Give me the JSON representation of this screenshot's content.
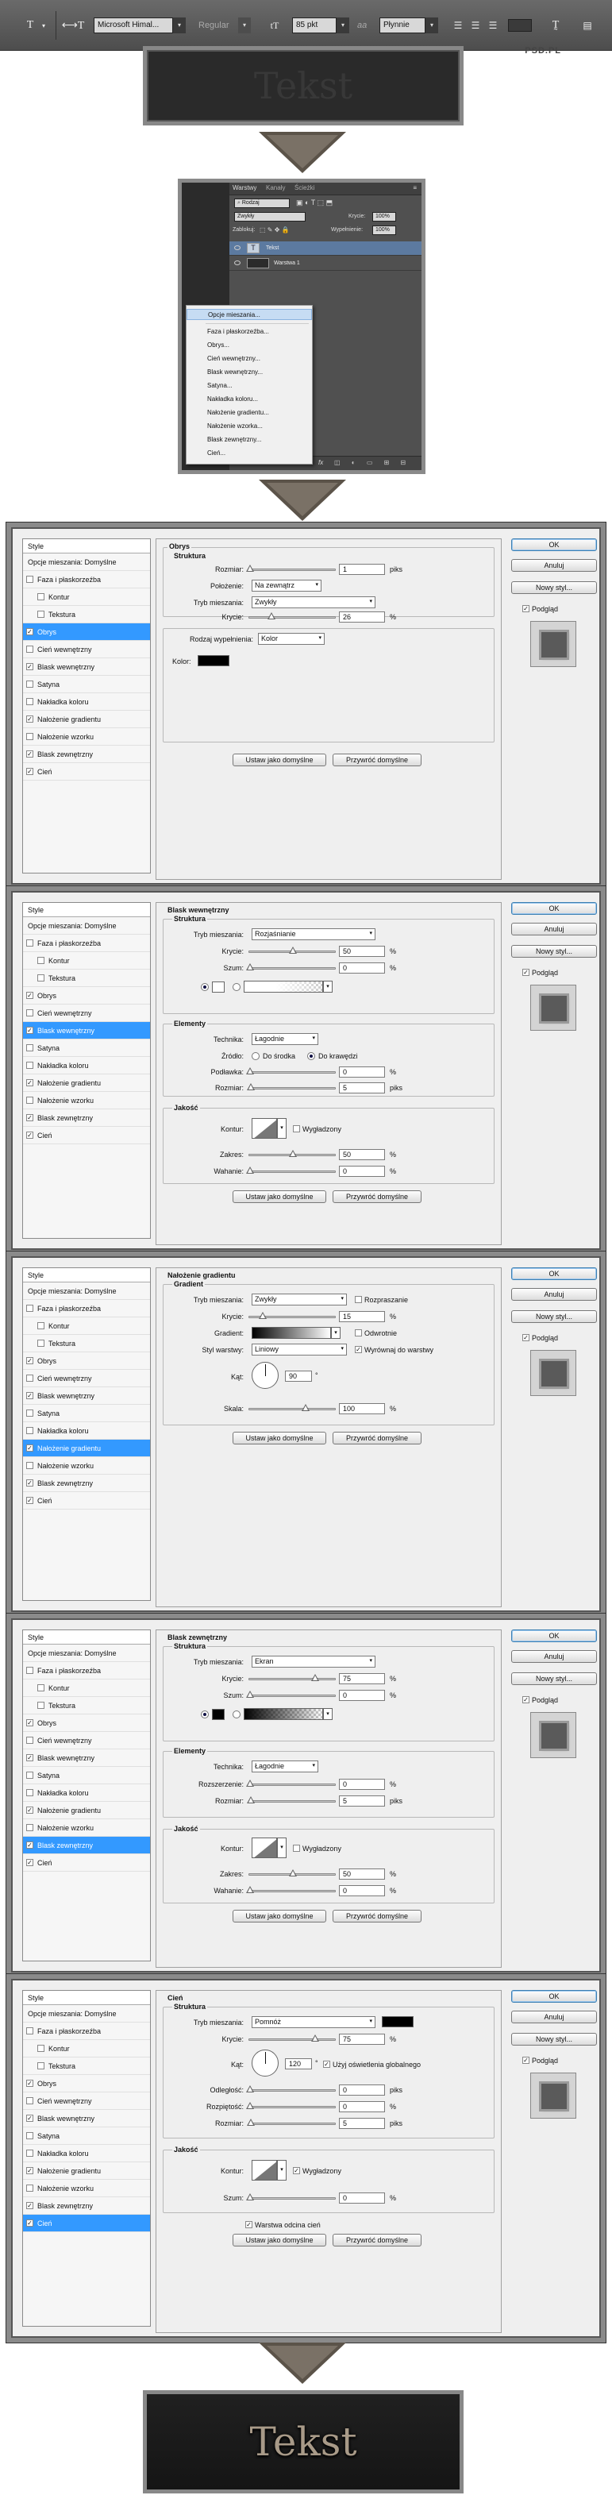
{
  "toolbar": {
    "font_family": "Microsoft Himal...",
    "font_style": "Regular",
    "font_size": "85 pkt",
    "aa_label": "aa",
    "antialias": "Płynnie",
    "watermark": "PSD.PL"
  },
  "top_text": "Tekst",
  "bottom_text": "Tekst",
  "layers_panel": {
    "tabs": [
      "Warstwy",
      "Kanały",
      "Ścieżki"
    ],
    "filter_label": "Rodzaj",
    "blend_mode": "Zwykły",
    "opacity_label": "Krycie:",
    "opacity_value": "100%",
    "lock_label": "Zablokuj:",
    "fill_label": "Wypełnienie:",
    "fill_value": "100%",
    "layers": [
      "Tekst",
      "Warstwa 1"
    ],
    "fx_label": "fx"
  },
  "context_menu": {
    "items": [
      "Opcje mieszania...",
      "Faza i płaskorzeźba...",
      "Obrys...",
      "Cień wewnętrzny...",
      "Blask wewnętrzny...",
      "Satyna...",
      "Nakładka koloru...",
      "Nałożenie gradientu...",
      "Nałożenie wzorka...",
      "Blask zewnętrzny...",
      "Cień..."
    ]
  },
  "style_list": {
    "header": "Style",
    "items": [
      "Opcje mieszania: Domyślne",
      "Faza i płaskorzeźba",
      "Kontur",
      "Tekstura",
      "Obrys",
      "Cień wewnętrzny",
      "Blask wewnętrzny",
      "Satyna",
      "Nakładka koloru",
      "Nałożenie gradientu",
      "Nałożenie wzorku",
      "Blask zewnętrzny",
      "Cień"
    ]
  },
  "buttons": {
    "ok": "OK",
    "cancel": "Anuluj",
    "new_style": "Nowy styl...",
    "preview": "Podgląd",
    "set_default": "Ustaw jako domyślne",
    "reset_default": "Przywróć domyślne"
  },
  "stroke": {
    "title": "Obrys",
    "sub": "Struktura",
    "size_label": "Rozmiar:",
    "size": "1",
    "size_unit": "piks",
    "position_label": "Położenie:",
    "position": "Na zewnątrz",
    "blend_label": "Tryb mieszania:",
    "blend": "Zwykły",
    "opacity_label": "Krycie:",
    "opacity": "26",
    "pct": "%",
    "fill_type_label": "Rodzaj wypełnienia:",
    "fill_type": "Kolor",
    "color_label": "Kolor:",
    "color": "#000000"
  },
  "inner_glow": {
    "title": "Blask wewnętrzny",
    "sub": "Struktura",
    "blend_label": "Tryb mieszania:",
    "blend": "Rozjaśnianie",
    "opacity_label": "Krycie:",
    "opacity": "50",
    "noise_label": "Szum:",
    "noise": "0",
    "pct": "%",
    "elements": "Elementy",
    "technique_label": "Technika:",
    "technique": "Łagodnie",
    "source_label": "Źródło:",
    "src_center": "Do środka",
    "src_edge": "Do krawędzi",
    "choke_label": "Podławka:",
    "choke": "0",
    "size_label": "Rozmiar:",
    "size": "5",
    "px": "piks",
    "quality": "Jakość",
    "contour_label": "Kontur:",
    "smooth_label": "Wygładzony",
    "range_label": "Zakres:",
    "range": "50",
    "jitter_label": "Wahanie:",
    "jitter": "0"
  },
  "gradient": {
    "title": "Nałożenie gradientu",
    "sub": "Gradient",
    "blend_label": "Tryb mieszania:",
    "blend": "Zwykły",
    "dither_label": "Rozpraszanie",
    "opacity_label": "Krycie:",
    "opacity": "15",
    "pct": "%",
    "gradient_label": "Gradient:",
    "reverse_label": "Odwrotnie",
    "style_label": "Styl warstwy:",
    "style": "Liniowy",
    "align_label": "Wyrównaj do warstwy",
    "angle_label": "Kąt:",
    "angle": "90",
    "deg": "°",
    "scale_label": "Skala:",
    "scale": "100"
  },
  "outer_glow": {
    "title": "Blask zewnętrzny",
    "sub": "Struktura",
    "blend_label": "Tryb mieszania:",
    "blend": "Ekran",
    "opacity_label": "Krycie:",
    "opacity": "75",
    "noise_label": "Szum:",
    "noise": "0",
    "pct": "%",
    "elements": "Elementy",
    "technique_label": "Technika:",
    "technique": "Łagodnie",
    "spread_label": "Rozszerzenie:",
    "spread": "0",
    "size_label": "Rozmiar:",
    "size": "5",
    "px": "piks",
    "quality": "Jakość",
    "contour_label": "Kontur:",
    "smooth_label": "Wygładzony",
    "range_label": "Zakres:",
    "range": "50",
    "jitter_label": "Wahanie:",
    "jitter": "0"
  },
  "shadow": {
    "title": "Cień",
    "sub": "Struktura",
    "blend_label": "Tryb mieszania:",
    "blend": "Pomnóż",
    "opacity_label": "Krycie:",
    "opacity": "75",
    "pct": "%",
    "angle_label": "Kąt:",
    "angle": "120",
    "deg": "°",
    "global_label": "Użyj oświetlenia globalnego",
    "distance_label": "Odległość:",
    "distance": "0",
    "spread_label": "Rozpiętość:",
    "spread": "0",
    "size_label": "Rozmiar:",
    "size": "5",
    "px": "piks",
    "quality": "Jakość",
    "contour_label": "Kontur:",
    "smooth_label": "Wygładzony",
    "noise_label": "Szum:",
    "noise": "0",
    "knockout_label": "Warstwa odcina cień"
  },
  "checked_states": [
    [
      false,
      false,
      false,
      false,
      true,
      false,
      true,
      false,
      false,
      true,
      false,
      true,
      true
    ],
    [
      false,
      false,
      false,
      false,
      true,
      false,
      true,
      false,
      false,
      true,
      false,
      true,
      true
    ],
    [
      false,
      false,
      false,
      false,
      true,
      false,
      true,
      false,
      false,
      true,
      false,
      true,
      true
    ],
    [
      false,
      false,
      false,
      false,
      true,
      false,
      true,
      false,
      false,
      true,
      false,
      true,
      true
    ],
    [
      false,
      false,
      false,
      false,
      true,
      false,
      true,
      false,
      false,
      true,
      false,
      true,
      true
    ]
  ],
  "selected_styles": [
    4,
    6,
    9,
    11,
    12
  ]
}
